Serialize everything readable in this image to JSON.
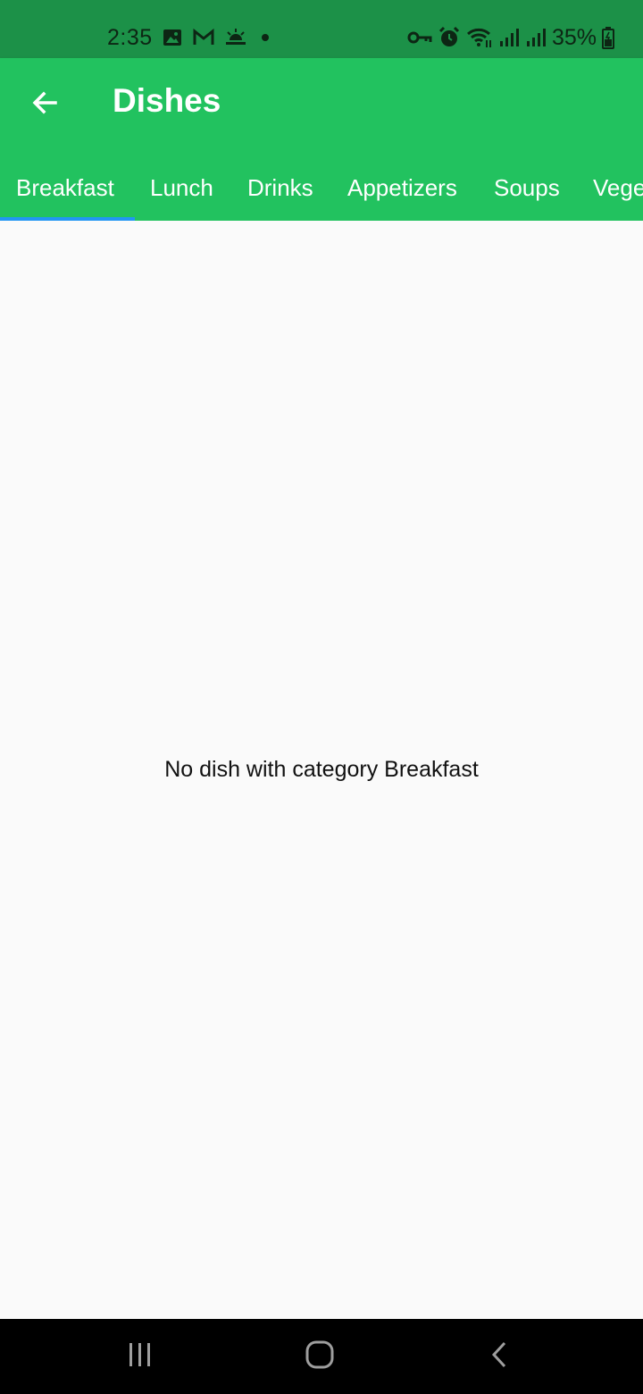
{
  "status_bar": {
    "time": "2:35",
    "battery": "35%",
    "left_icons": [
      "gallery-icon",
      "gmail-icon",
      "weather-icon",
      "dot-icon"
    ],
    "right_icons": [
      "vpn-key-icon",
      "alarm-icon",
      "wifi-icon",
      "signal-icon",
      "signal-icon",
      "battery-icon"
    ]
  },
  "app_bar": {
    "title": "Dishes",
    "back_icon": "arrow-back-icon",
    "color": "#22C25F"
  },
  "tabs": [
    {
      "label": "Breakfast",
      "selected": true
    },
    {
      "label": "Lunch",
      "selected": false
    },
    {
      "label": "Drinks",
      "selected": false
    },
    {
      "label": "Appetizers",
      "selected": false
    },
    {
      "label": "Soups",
      "selected": false
    },
    {
      "label": "Vege",
      "selected": false
    }
  ],
  "indicator_color": "#2196F3",
  "content": {
    "empty_message": "No dish with category Breakfast"
  },
  "nav_bar": {
    "recents_icon": "recents-icon",
    "home_icon": "home-icon",
    "back_icon": "nav-back-icon"
  }
}
